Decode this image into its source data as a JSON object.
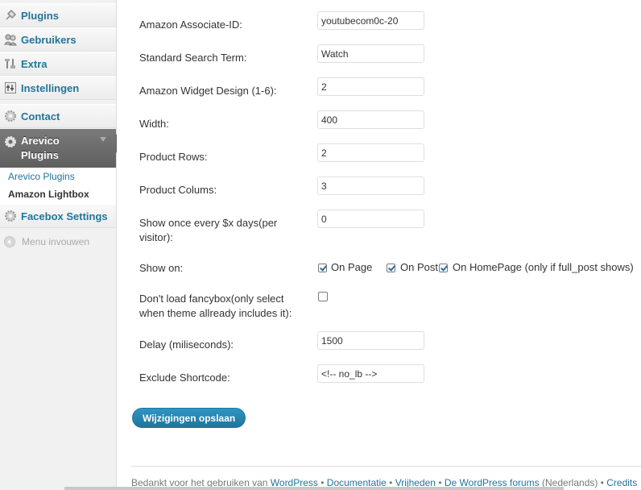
{
  "sidebar": {
    "items": [
      {
        "label": "Plugins",
        "icon": "plugin-icon"
      },
      {
        "label": "Gebruikers",
        "icon": "users-icon"
      },
      {
        "label": "Extra",
        "icon": "tools-icon"
      },
      {
        "label": "Instellingen",
        "icon": "settings-icon"
      },
      {
        "label": "Contact",
        "icon": "gear-icon"
      },
      {
        "label": "Arevico Plugins",
        "icon": "gear-icon"
      },
      {
        "label": "Facebox Settings",
        "icon": "gear-icon"
      }
    ],
    "active_label_line1": "Arevico",
    "active_label_line2": "Plugins",
    "submenu": [
      "Arevico Plugins",
      "Amazon Lightbox"
    ],
    "collapse_label": "Menu invouwen"
  },
  "form": {
    "associate_id": {
      "label": "Amazon Associate-ID:",
      "value": "youtubecom0c-20"
    },
    "search_term": {
      "label": "Standard Search Term:",
      "value": "Watch"
    },
    "widget_design": {
      "label": "Amazon Widget Design (1-6):",
      "value": "2"
    },
    "width": {
      "label": "Width:",
      "value": "400"
    },
    "product_rows": {
      "label": "Product Rows:",
      "value": "2"
    },
    "product_columns": {
      "label": "Product Colums:",
      "value": "3"
    },
    "show_once": {
      "label_line1": "Show once every $x days(per",
      "label_line2": "visitor):",
      "value": "0"
    },
    "show_on": {
      "label": "Show on:",
      "options": [
        {
          "label": "On Page",
          "checked": true
        },
        {
          "label": "On Post",
          "checked": true
        },
        {
          "label": "On HomePage (only if full_post shows)",
          "checked": true
        }
      ]
    },
    "fancybox": {
      "label_line1": "Don't load fancybox(only select",
      "label_line2": "when theme allready includes it):",
      "checked": false
    },
    "delay": {
      "label": "Delay (miliseconds):",
      "value": "1500"
    },
    "exclude_shortcode": {
      "label": "Exclude Shortcode:",
      "value": "<!-- no_lb -->"
    },
    "save_label": "Wijzigingen opslaan"
  },
  "footer": {
    "thanks": "Bedankt voor het gebruiken van ",
    "wordpress": "WordPress",
    "sep": " • ",
    "docs": "Documentatie",
    "freedoms": "Vrijheden",
    "forums": "De WordPress forums",
    "lang": " (Nederlands) • ",
    "credits": "Credits"
  },
  "colors": {
    "link": "#21759b",
    "active_menu": "#6d6d6d",
    "button": "#21759b"
  }
}
